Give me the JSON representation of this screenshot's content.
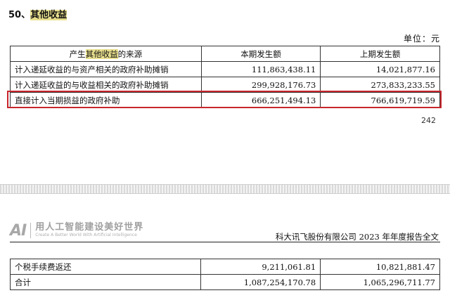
{
  "heading": {
    "prefix": "50、",
    "highlight": "其他收益"
  },
  "unit_label": "单位：元",
  "table1": {
    "header": {
      "col1_pre": "产生",
      "col1_hl": "其他收益",
      "col1_post": "的来源",
      "col2": "本期发生额",
      "col3": "上期发生额"
    },
    "rows": [
      {
        "label": "计入递延收益的与资产相关的政府补助摊销",
        "current": "111,863,438.11",
        "previous": "14,021,877.16"
      },
      {
        "label": "计入递延收益的与收益相关的政府补助摊销",
        "current": "299,928,176.73",
        "previous": "273,833,233.55"
      },
      {
        "label": "直接计入当期损益的政府补助",
        "current": "666,251,494.13",
        "previous": "766,619,719.59"
      }
    ]
  },
  "page_number": "242",
  "watermark": {
    "logo": "AI",
    "title": "用人工智能建设美好世界",
    "subtitle": "Create A Better World With Artificial Intelligence"
  },
  "report_title": "科大讯飞股份有限公司 2023 年年度报告全文",
  "table2": {
    "rows": [
      {
        "label": "个税手续费返还",
        "current": "9,211,061.81",
        "previous": "10,821,881.47"
      },
      {
        "label": "合计",
        "current": "1,087,254,170.78",
        "previous": "1,065,296,711.77"
      }
    ]
  }
}
